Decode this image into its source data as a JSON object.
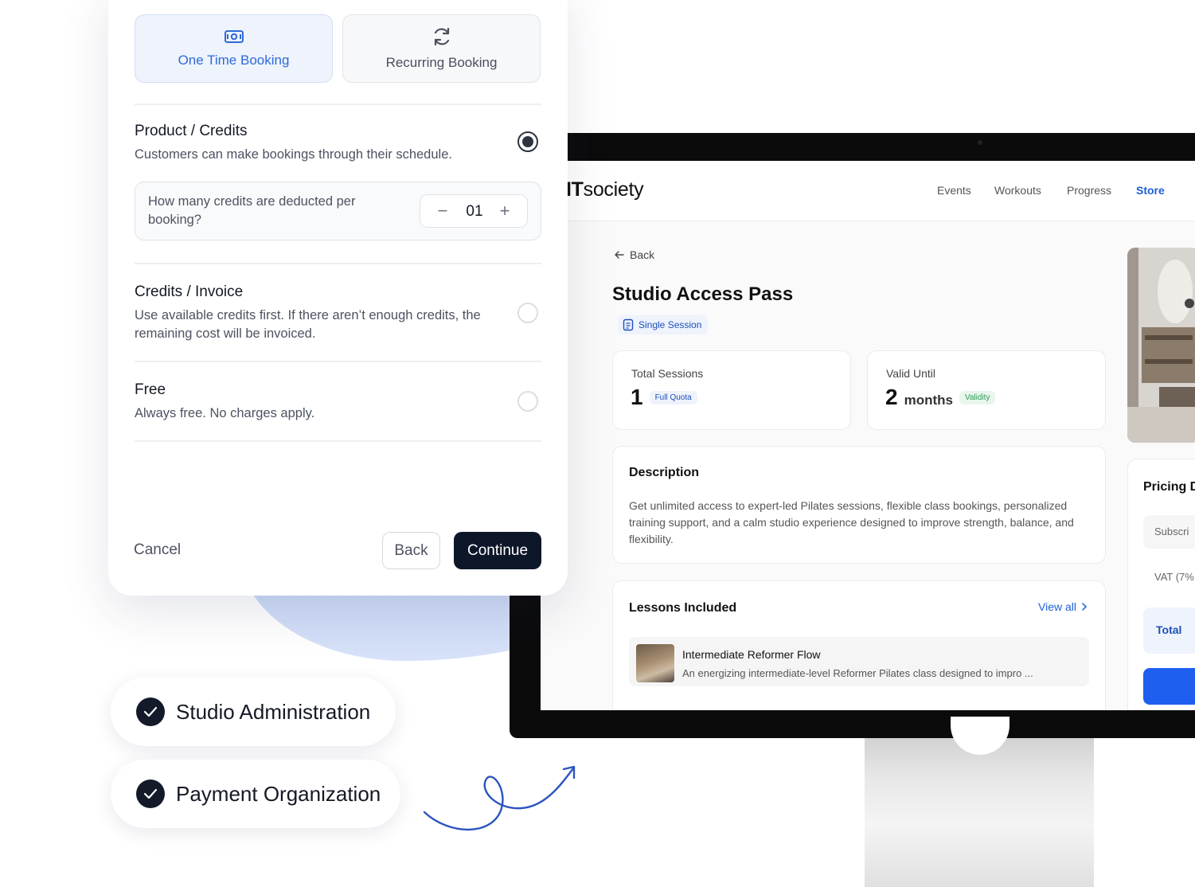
{
  "booking_panel": {
    "booking_types": [
      {
        "label": "One Time Booking",
        "icon": "cash-icon",
        "selected": true
      },
      {
        "label": "Recurring Booking",
        "icon": "refresh-icon",
        "selected": false
      }
    ],
    "options": [
      {
        "title": "Product / Credits",
        "description": "Customers can make bookings through their schedule.",
        "selected": true
      },
      {
        "title": "Credits / Invoice",
        "description": "Use available credits first. If there aren’t enough credits, the remaining cost will be invoiced.",
        "selected": false
      },
      {
        "title": "Free",
        "description": "Always free. No charges apply.",
        "selected": false
      }
    ],
    "credits_question": "How many credits are deducted per booking?",
    "credits_value": "01",
    "cancel_label": "Cancel",
    "back_label": "Back",
    "continue_label": "Continue"
  },
  "features": [
    {
      "label": "Studio Administration"
    },
    {
      "label": "Payment Organization"
    }
  ],
  "site": {
    "logo_bold": "IT",
    "logo_rest": "society",
    "nav": [
      "Events",
      "Workouts",
      "Progress",
      "Store"
    ],
    "active_nav": "Store",
    "back_label": "Back",
    "product_title": "Studio Access Pass",
    "session_chip": "Single Session",
    "stats": [
      {
        "label": "Total Sessions",
        "value": "1",
        "unit": "",
        "tag": "Full Quota"
      },
      {
        "label": "Valid Until",
        "value": "2",
        "unit": "months",
        "tag": "Validity"
      }
    ],
    "description_heading": "Description",
    "description_text": "Get unlimited access to expert-led Pilates sessions, flexible class bookings, personalized training support, and a calm studio experience designed to improve strength, balance, and flexibility.",
    "lessons_heading": "Lessons Included",
    "view_all_label": "View all",
    "lesson": {
      "title": "Intermediate Reformer Flow",
      "subtitle": "An energizing intermediate-level Reformer Pilates class designed to impro ..."
    },
    "pricing": {
      "heading": "Pricing D",
      "subscription_label": "Subscri",
      "vat_label": "VAT (7%",
      "total_label": "Total"
    }
  },
  "colors": {
    "accent": "#1d5fd6",
    "dark_button": "#0e1729",
    "selected_bg": "#eef3fc",
    "validity_green": "#2b9c54"
  }
}
